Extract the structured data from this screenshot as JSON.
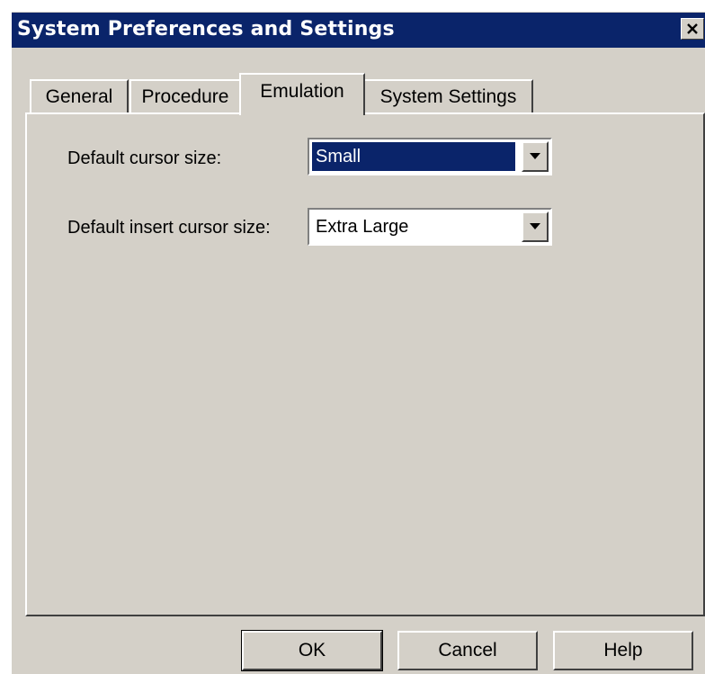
{
  "window": {
    "title": "System Preferences and Settings",
    "close_icon": "close-x-icon"
  },
  "tabs": [
    {
      "label": "General",
      "active": false
    },
    {
      "label": "Procedure",
      "active": false
    },
    {
      "label": "Emulation",
      "active": true
    },
    {
      "label": "System Settings",
      "active": false
    }
  ],
  "emulation": {
    "cursor_size": {
      "label": "Default cursor size:",
      "value": "Small",
      "focused": true
    },
    "insert_cursor_size": {
      "label": "Default insert cursor size:",
      "value": "Extra Large",
      "focused": false
    }
  },
  "buttons": {
    "ok": "OK",
    "cancel": "Cancel",
    "help": "Help"
  },
  "colors": {
    "title_bar": "#0a246a",
    "dialog_bg": "#d4d0c8",
    "selection": "#0a246a"
  }
}
